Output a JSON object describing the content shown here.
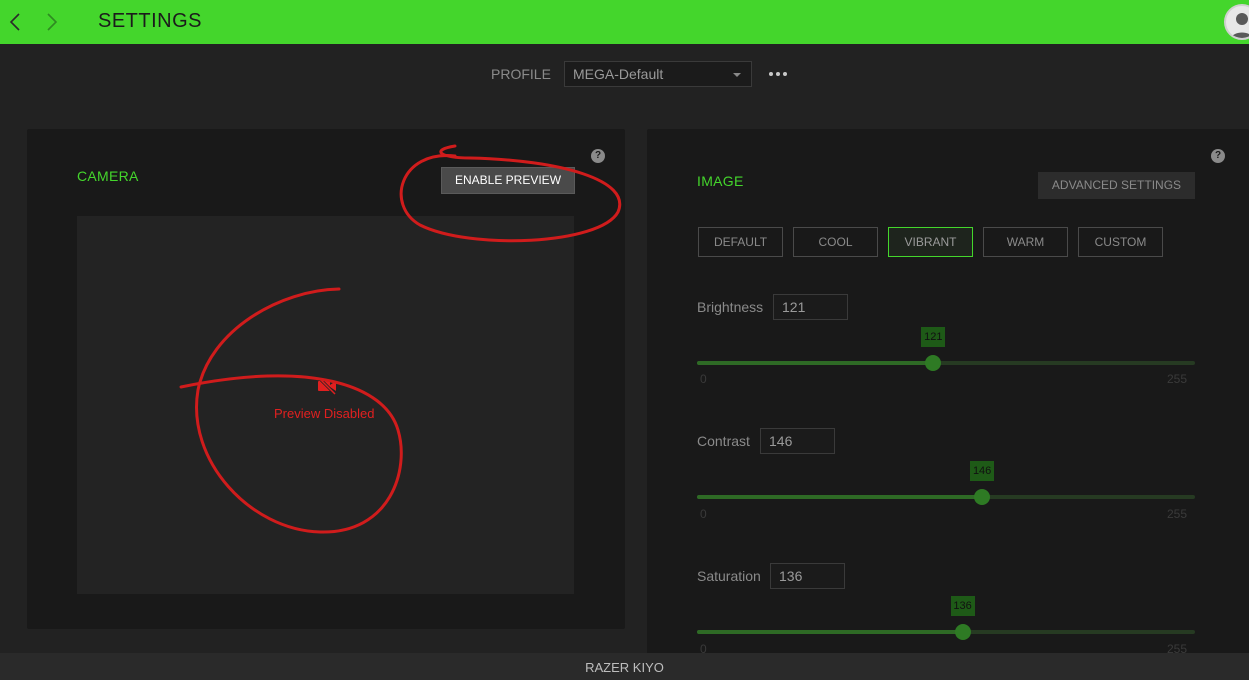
{
  "header": {
    "title": "SETTINGS",
    "back_icon": "chevron-left-icon",
    "forward_icon": "chevron-right-icon",
    "avatar_icon": "user-avatar-icon",
    "accent": "#44d62c"
  },
  "profile": {
    "label": "PROFILE",
    "value": "MEGA-Default"
  },
  "camera": {
    "title": "CAMERA",
    "enable_preview_label": "ENABLE PREVIEW",
    "preview_status": "Preview Disabled",
    "status_color": "#e02020"
  },
  "image": {
    "title": "IMAGE",
    "advanced_label": "ADVANCED SETTINGS",
    "presets": [
      "DEFAULT",
      "COOL",
      "VIBRANT",
      "WARM",
      "CUSTOM"
    ],
    "active_preset": "VIBRANT",
    "sliders": [
      {
        "label": "Brightness",
        "value": 121,
        "min": 0,
        "max": 255
      },
      {
        "label": "Contrast",
        "value": 146,
        "min": 0,
        "max": 255
      },
      {
        "label": "Saturation",
        "value": 136,
        "min": 0,
        "max": 255
      }
    ]
  },
  "footer": {
    "device_name": "RAZER KIYO"
  }
}
